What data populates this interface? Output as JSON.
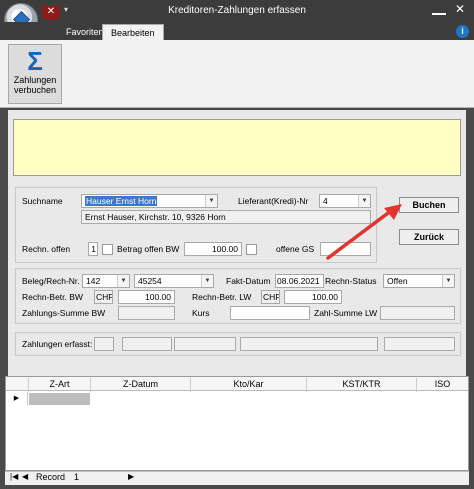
{
  "window": {
    "title": "Kreditoren-Zahlungen erfassen",
    "close_glyph": "✕",
    "qat_close_glyph": "✕",
    "qat_more_glyph": "▾",
    "help_glyph": "i"
  },
  "tabs": [
    {
      "label": "Favoriten"
    },
    {
      "label": "Bearbeiten",
      "active": true
    }
  ],
  "ribbon": {
    "zahlungen_icon": "Σ",
    "zahlungen_label_1": "Zahlungen",
    "zahlungen_label_2": "verbuchen"
  },
  "message": "",
  "section1": {
    "suchname_label": "Suchname",
    "suchname_value": "Hauser Ernst Horn",
    "address": "Ernst Hauser, Kirchstr. 10, 9326 Horn",
    "lieferant_label": "Lieferant(Kredi)-Nr",
    "lieferant_value": "4",
    "rechn_offen_label": "Rechn. offen",
    "rechn_offen_value": "1",
    "betrag_offen_label": "Betrag offen BW",
    "betrag_offen_value": "100.00",
    "offene_gs_label": "offene GS",
    "buchen_label": "Buchen",
    "zurueck_label": "Zurück"
  },
  "section2": {
    "beleg_label": "Beleg/Rech-Nr.",
    "beleg_value": "142",
    "rech_nr_value": "45254",
    "fakt_datum_label": "Fakt-Datum",
    "fakt_datum_value": "08.06.2021",
    "rechn_status_label": "Rechn-Status",
    "rechn_status_value": "Offen",
    "betr_bw_label": "Rechn-Betr. BW",
    "currency_bw": "CHF",
    "betr_bw_value": "100.00",
    "betr_lw_label": "Rechn-Betr. LW",
    "currency_lw": "CHF",
    "betr_lw_value": "100.00",
    "zahlungs_summe_label": "Zahlungs-Summe BW",
    "kurs_label": "Kurs",
    "zahl_summe_lw_label": "Zahl-Summe LW"
  },
  "section3": {
    "zahlungen_erfasst_label": "Zahlungen erfasst:"
  },
  "grid": {
    "columns": [
      "Z-Art",
      "Z-Datum",
      "Kto/Kar",
      "KST/KTR",
      "ISO"
    ],
    "row_marker": "▶"
  },
  "navigator": {
    "label": "Record",
    "current": "1",
    "first_glyph": "|◀",
    "prev_glyph": "◀",
    "next_glyph": "▶"
  },
  "colors": {
    "accent": "#1c63b8",
    "message_bg": "#ffffc4",
    "arrow": "#e0342c"
  }
}
